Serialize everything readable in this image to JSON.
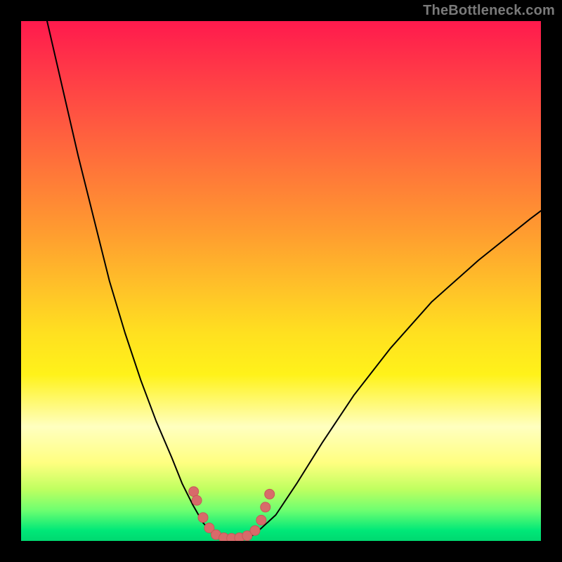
{
  "watermark": "TheBottleneck.com",
  "colors": {
    "curve_stroke": "#000000",
    "marker_fill": "#d86a6a",
    "marker_stroke": "#c85858"
  },
  "chart_data": {
    "type": "line",
    "title": "",
    "xlabel": "",
    "ylabel": "",
    "xlim": [
      0,
      100
    ],
    "ylim": [
      0,
      100
    ],
    "series": [
      {
        "name": "left-branch",
        "x": [
          5,
          8,
          11,
          14,
          17,
          20,
          23,
          26,
          29,
          31,
          33,
          35,
          36.5
        ],
        "y": [
          100,
          87,
          74,
          62,
          50,
          40,
          31,
          23,
          16,
          11,
          7,
          3.5,
          1.8
        ]
      },
      {
        "name": "valley",
        "x": [
          36.5,
          38,
          40,
          42,
          44,
          45.5
        ],
        "y": [
          1.8,
          0.6,
          0.4,
          0.4,
          0.7,
          1.8
        ]
      },
      {
        "name": "right-branch",
        "x": [
          45.5,
          49,
          53,
          58,
          64,
          71,
          79,
          88,
          98,
          100
        ],
        "y": [
          1.8,
          5,
          11,
          19,
          28,
          37,
          46,
          54,
          62,
          63.5
        ]
      }
    ],
    "markers": {
      "name": "highlighted-points",
      "x": [
        33.2,
        33.8,
        35.0,
        36.2,
        37.5,
        39.0,
        40.5,
        42.0,
        43.5,
        45.0,
        46.2,
        47.0,
        47.8
      ],
      "y": [
        9.5,
        7.8,
        4.5,
        2.5,
        1.2,
        0.6,
        0.5,
        0.6,
        1.0,
        2.0,
        4.0,
        6.5,
        9.0
      ]
    }
  }
}
